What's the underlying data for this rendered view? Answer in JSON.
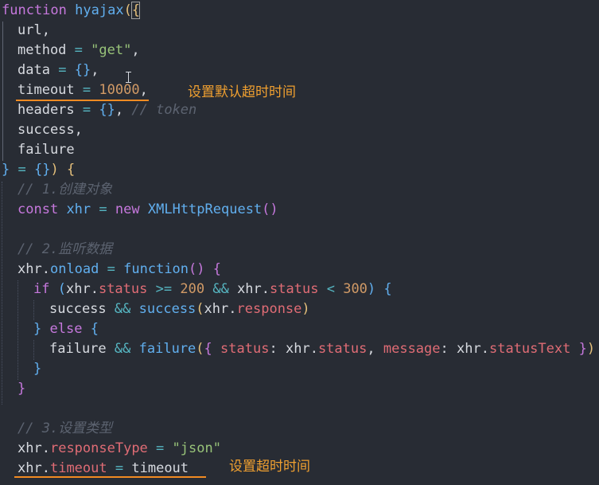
{
  "code": {
    "l01": {
      "kw": "function",
      "name": "hyajax",
      "open": "({"
    },
    "l02": {
      "p": "url,"
    },
    "l03": {
      "p": "method",
      "eq": "=",
      "str": "\"get\"",
      "c": ","
    },
    "l04": {
      "p": "data",
      "eq": "=",
      "br": "{}",
      "c": ","
    },
    "l05": {
      "p": "timeout",
      "eq": "=",
      "num": "10000",
      "c": ","
    },
    "l06": {
      "p": "headers",
      "eq": "=",
      "br": "{}",
      "c": ",",
      "cmt": "// token"
    },
    "l07": {
      "p": "success,"
    },
    "l08": {
      "p": "failure"
    },
    "l09": {
      "close": "}",
      "eq": "=",
      "br": "{}",
      "paren": ")",
      "open": "{"
    },
    "l10": {
      "cmt": "// 1.创建对象"
    },
    "l11": {
      "kw": "const",
      "v": "xhr",
      "eq": "=",
      "kw2": "new",
      "cls": "XMLHttpRequest",
      "paren": "()"
    },
    "l13": {
      "cmt": "// 2.监听数据"
    },
    "l14": {
      "obj": "xhr",
      "dot": ".",
      "prop": "onload",
      "eq": "=",
      "kw": "function",
      "paren": "()",
      "open": "{"
    },
    "l15": {
      "kw": "if",
      "p1": "(",
      "obj1": "xhr",
      "prop1": "status",
      "op1": ">=",
      "n1": "200",
      "and": "&&",
      "obj2": "xhr",
      "prop2": "status",
      "op2": "<",
      "n2": "300",
      "p2": ")",
      "open": "{"
    },
    "l16": {
      "a": "success",
      "and": "&&",
      "fn": "success",
      "p1": "(",
      "obj": "xhr",
      "prop": "response",
      "p2": ")"
    },
    "l17": {
      "close": "}",
      "kw": "else",
      "open": "{"
    },
    "l18": {
      "a": "failure",
      "and": "&&",
      "fn": "failure",
      "p1": "(",
      "o": "{",
      "k1": "status",
      "col1": ":",
      "obj1": "xhr",
      "prop1": "status",
      "cm": ",",
      "k2": "message",
      "col2": ":",
      "obj2": "xhr",
      "prop2": "statusText",
      "c": "}",
      "p2": ")"
    },
    "l19": {
      "close": "}"
    },
    "l20": {
      "close": "}"
    },
    "l22": {
      "cmt": "// 3.设置类型"
    },
    "l23": {
      "obj": "xhr",
      "prop": "responseType",
      "eq": "=",
      "str": "\"json\""
    },
    "l24": {
      "obj": "xhr",
      "prop": "timeout",
      "eq": "=",
      "v": "timeout"
    }
  },
  "annotations": {
    "note1": "设置默认超时时间",
    "note2": "设置超时时间"
  },
  "colors": {
    "background": "#282c34",
    "annotation": "#f0a030",
    "underline": "#f28b22"
  }
}
